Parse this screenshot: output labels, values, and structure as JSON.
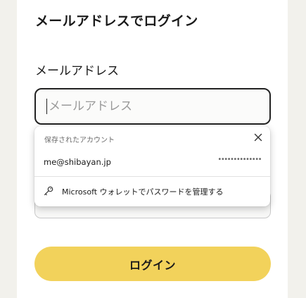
{
  "page": {
    "title": "メールアドレスでログイン"
  },
  "form": {
    "email_label": "メールアドレス",
    "email_value": "",
    "email_placeholder": "メールアドレス",
    "login_button_label": "ログイン"
  },
  "autofill_popup": {
    "header": "保存されたアカウント",
    "close_icon": "close-icon",
    "accounts": [
      {
        "email": "me@shibayan.jp",
        "password_mask": "••••••••••••••"
      }
    ],
    "manage_label": "Microsoft ウォレットでパスワードを管理する",
    "manage_icon": "key-icon"
  },
  "colors": {
    "button_bg": "#f2d25b",
    "page_bg": "#f2f1ec",
    "card_bg": "#ffffff",
    "field_border": "#222222"
  }
}
